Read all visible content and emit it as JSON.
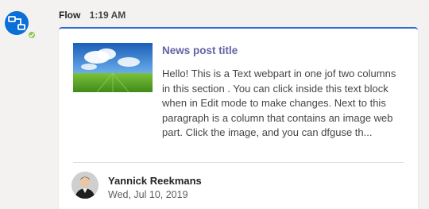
{
  "message": {
    "sender": "Flow",
    "time": "1:19 AM"
  },
  "card": {
    "news_title": "News post title",
    "news_body": "Hello! This is a Text webpart in one jof two columns in this section . You can click inside this text block when in Edit mode to make changes. Next to this paragraph is a column that contains an image web part. Click the image, and you can dfguse th...",
    "author_name": "Yannick Reekmans",
    "post_date": "Wed, Jul 10, 2019"
  },
  "colors": {
    "accent": "#2f6bd6",
    "title": "#6264a7",
    "bot_avatar": "#0a6fd6",
    "presence": "#92c353"
  },
  "icons": {
    "bot": "flow-icon",
    "presence": "check-icon"
  }
}
